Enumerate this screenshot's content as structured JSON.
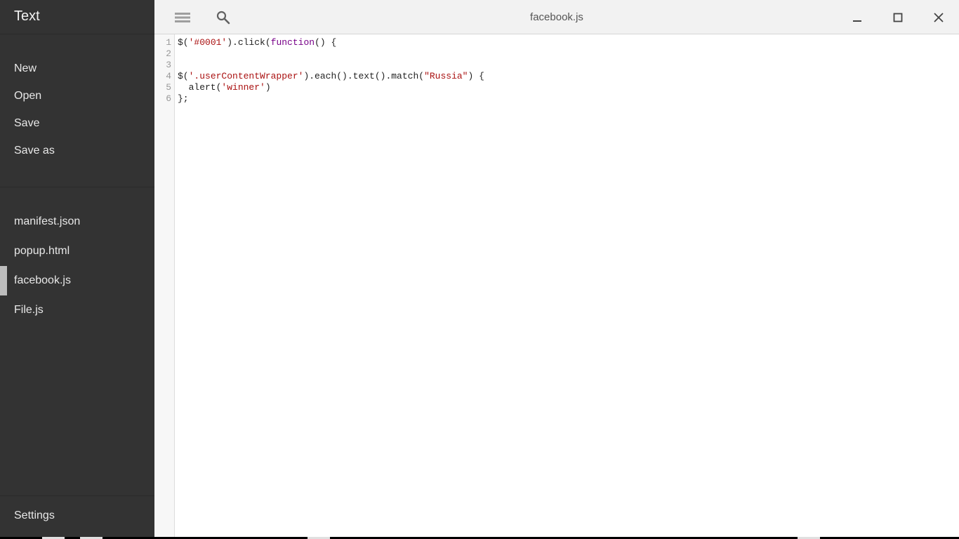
{
  "app": {
    "title": "Text"
  },
  "menu": [
    {
      "label": "New"
    },
    {
      "label": "Open"
    },
    {
      "label": "Save"
    },
    {
      "label": "Save as"
    }
  ],
  "files": [
    {
      "label": "manifest.json",
      "active": false
    },
    {
      "label": "popup.html",
      "active": false
    },
    {
      "label": "facebook.js",
      "active": true
    },
    {
      "label": "File.js",
      "active": false
    }
  ],
  "settings": {
    "label": "Settings"
  },
  "toolbar": {
    "menu_icon": "hamburger-icon",
    "search_icon": "search-icon",
    "document_title": "facebook.js",
    "minimize_icon": "minimize-icon",
    "maximize_icon": "maximize-icon",
    "close_icon": "close-icon"
  },
  "editor": {
    "lines": [
      {
        "num": "1",
        "tokens": [
          {
            "t": "$(",
            "c": "plain"
          },
          {
            "t": "'#0001'",
            "c": "str"
          },
          {
            "t": ").click(",
            "c": "plain"
          },
          {
            "t": "function",
            "c": "kw"
          },
          {
            "t": "() {",
            "c": "plain"
          }
        ]
      },
      {
        "num": "2",
        "tokens": []
      },
      {
        "num": "3",
        "tokens": []
      },
      {
        "num": "4",
        "tokens": [
          {
            "t": "$(",
            "c": "plain"
          },
          {
            "t": "'.userContentWrapper'",
            "c": "str"
          },
          {
            "t": ").each().text().match(",
            "c": "plain"
          },
          {
            "t": "\"Russia\"",
            "c": "str"
          },
          {
            "t": ") {",
            "c": "plain"
          }
        ]
      },
      {
        "num": "5",
        "tokens": [
          {
            "t": "  alert(",
            "c": "plain"
          },
          {
            "t": "'winner'",
            "c": "str"
          },
          {
            "t": ")",
            "c": "plain"
          }
        ]
      },
      {
        "num": "6",
        "tokens": [
          {
            "t": "};",
            "c": "plain"
          }
        ]
      }
    ]
  },
  "colors": {
    "sidebar_bg": "#333333",
    "toolbar_bg": "#f2f2f2",
    "string_token": "#aa1111",
    "keyword_token": "#770088"
  }
}
